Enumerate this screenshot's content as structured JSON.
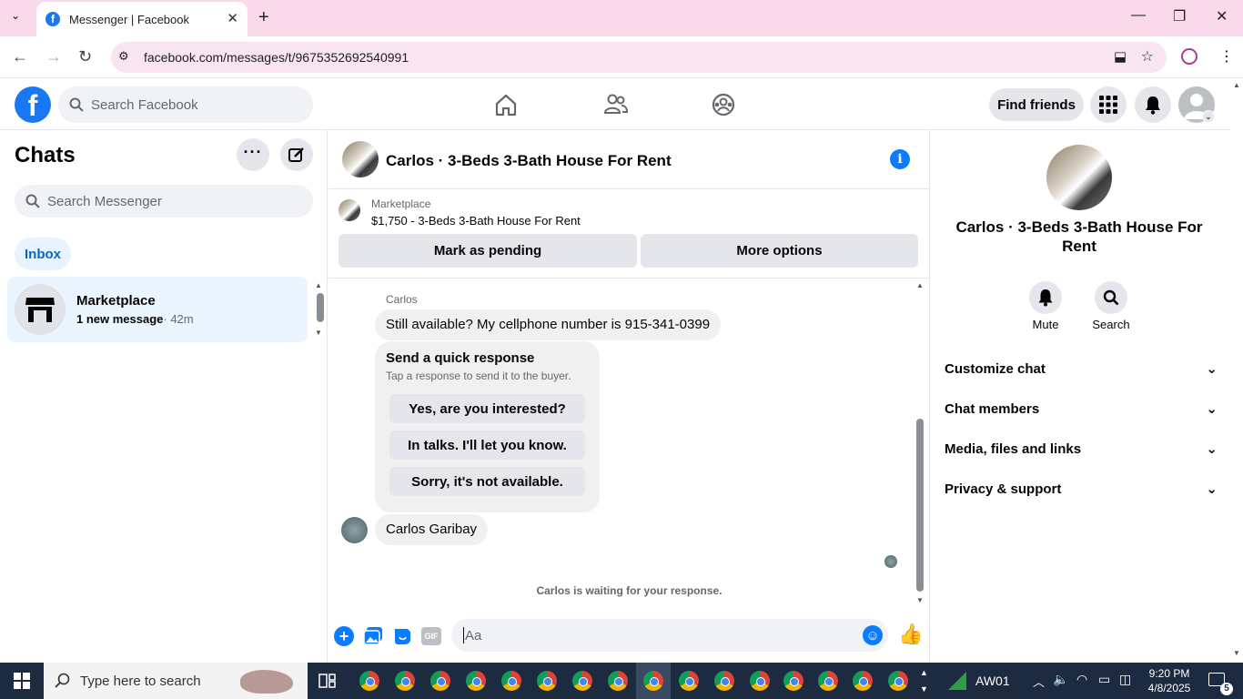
{
  "browser": {
    "tab_title": "Messenger | Facebook",
    "url": "facebook.com/messages/t/9675352692540991"
  },
  "fb": {
    "search_placeholder": "Search Facebook",
    "find_friends": "Find friends"
  },
  "sidebar": {
    "title": "Chats",
    "search_placeholder": "Search Messenger",
    "filter": "Inbox",
    "conversations": [
      {
        "name": "Marketplace",
        "preview": "1 new message",
        "time": "· 42m"
      }
    ]
  },
  "chat": {
    "title": "Carlos · 3-Beds 3-Bath House For Rent",
    "listing": {
      "label": "Marketplace",
      "price_title": "$1,750 - 3-Beds 3-Bath House For Rent",
      "mark_pending": "Mark as pending",
      "more_options": "More options"
    },
    "messages": [
      {
        "sender": "Carlos",
        "text": "Still available? My cellphone number is 915-341-0399"
      },
      {
        "sender": "Carlos Garibay",
        "text": "Carlos Garibay"
      }
    ],
    "quick_response": {
      "title": "Send a quick response",
      "subtitle": "Tap a response to send it to the buyer.",
      "options": [
        "Yes, are you interested?",
        "In talks. I'll let you know.",
        "Sorry, it's not available."
      ]
    },
    "waiting_text": "Carlos is waiting for your response.",
    "composer_placeholder": "Aa",
    "gif_label": "GIF"
  },
  "panel": {
    "name": "Carlos · 3-Beds 3-Bath House For Rent",
    "actions": [
      {
        "label": "Mute",
        "icon": "bell-icon"
      },
      {
        "label": "Search",
        "icon": "search-icon"
      }
    ],
    "sections": [
      "Customize chat",
      "Chat members",
      "Media, files and links",
      "Privacy & support"
    ]
  },
  "taskbar": {
    "search_placeholder": "Type here to search",
    "network_label": "AW01",
    "time": "9:20 PM",
    "date": "4/8/2025",
    "notif_count": "5"
  },
  "colors": {
    "fb_blue": "#1877f2",
    "messenger_blue": "#0a7cff",
    "tabbar_pink": "#f9d9ea"
  }
}
